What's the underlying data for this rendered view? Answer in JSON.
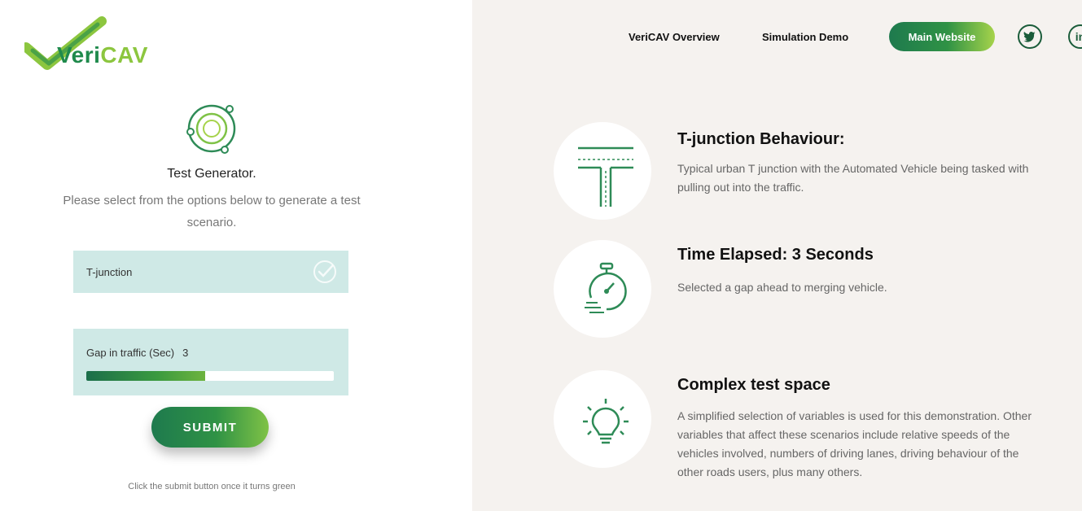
{
  "brand": {
    "logo_part1": "Veri",
    "logo_part2": "CAV"
  },
  "generator": {
    "title": "Test Generator.",
    "description": "Please select from the options below to generate a test scenario.",
    "scenario_select": {
      "value": "T-junction"
    },
    "gap": {
      "label": "Gap in traffic (Sec)",
      "value": "3",
      "fill_fraction": 0.48
    },
    "submit_label": "SUBMIT",
    "hint": "Click the submit button once it turns green"
  },
  "nav": {
    "items": [
      {
        "label": "VeriCAV Overview"
      },
      {
        "label": "Simulation Demo"
      }
    ],
    "main_button": "Main Website",
    "social": [
      {
        "icon": "twitter-icon"
      },
      {
        "icon": "linkedin-icon",
        "glyph": "in"
      }
    ]
  },
  "features": [
    {
      "icon": "t-junction-icon",
      "title": "T-junction Behaviour:",
      "text": "Typical urban T junction with the Automated Vehicle being tasked with pulling out into the traffic."
    },
    {
      "icon": "stopwatch-icon",
      "title": "Time Elapsed: 3 Seconds",
      "text": "Selected a gap ahead to merging vehicle."
    },
    {
      "icon": "lightbulb-icon",
      "title": "Complex test space",
      "text": "A simplified selection of variables is used for this demonstration. Other variables that affect these scenarios include relative speeds of the vehicles involved, numbers of driving lanes, driving behaviour of the other roads users, plus many others."
    }
  ],
  "colors": {
    "brand_dark_green": "#1f8a4c",
    "brand_light_green": "#8cc63f",
    "input_bg": "#cfe9e6",
    "right_bg": "#f5f2ef"
  }
}
